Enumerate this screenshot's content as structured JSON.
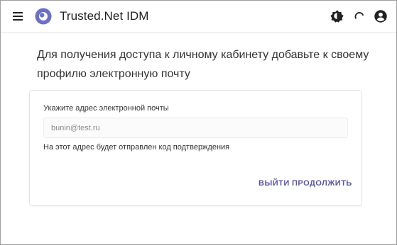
{
  "header": {
    "app_title": "Trusted.Net IDM",
    "icons": [
      "menu-icon",
      "app-logo-icon",
      "theme-toggle-icon",
      "loading-spinner-icon",
      "account-icon"
    ]
  },
  "main": {
    "heading": "Для получения доступа к личному кабинету добавьте к своему профилю электронную почту",
    "card": {
      "email_label": "Укажите адрес электронной почты",
      "email_placeholder": "bunin@test.ru",
      "email_value": "",
      "hint": "На этот адрес будет отправлен код подтверждения",
      "exit_label": "ВЫЙТИ",
      "continue_label": "ПРОДОЛЖИТЬ"
    }
  },
  "colors": {
    "accent": "#5b55a8",
    "logo": "#6b6fc6",
    "text": "#212121",
    "border": "#e3e3e3"
  }
}
